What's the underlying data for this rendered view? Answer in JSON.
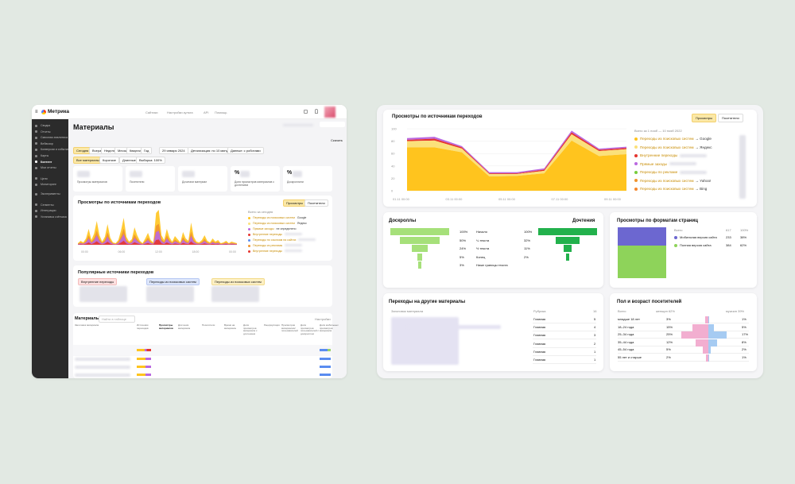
{
  "left_app": {
    "logo": "Метрика",
    "topnav": [
      "Сайтики",
      "Настройки культа",
      "API",
      "Помощь"
    ],
    "sidebar": [
      "Сводка",
      "Отчеты",
      "Сквозная аналитика",
      "Вебвизор",
      "Конверсии и события",
      "Карты",
      "Контент",
      "Мои отчеты",
      "Цели",
      "Мониторинг",
      "Эксперименты",
      "Сегменты",
      "Интеграции",
      "Установка счётчика"
    ],
    "page_title": "Материалы",
    "share": "Скачать",
    "date_tabs": [
      "Сегодня",
      "Вчера",
      "Неделя",
      "Месяц",
      "Квартал",
      "Год"
    ],
    "date_range": "29 января 2024",
    "detail": "Детализация: по 10 минут",
    "data": "Данные: с роботами",
    "filters": [
      "Все материалы",
      "Короткие",
      "Длинные",
      "Выборка: 100%"
    ],
    "metrics": [
      "Просмотры материалов",
      "Посетители",
      "Дочитали материал",
      "Доля просмотров материалов с дочтением",
      "Доскроллили"
    ],
    "metric_values": [
      "",
      "",
      "",
      "%",
      "%"
    ],
    "chart_title": "Просмотры по источникам переходов",
    "chart_toggle": [
      "Просмотры",
      "Посетители"
    ],
    "chart_period": "Всего за сегодня",
    "chart_legend": [
      "Переходы из поисковых систем",
      "Переходы из поисковых систем",
      "Прямые заходы",
      "Внутренние переходы",
      "Переходы по ссылкам на сайтах",
      "Переходы из рекламы",
      "Внутренние переходы"
    ],
    "chart_legend_targets": [
      "Google",
      "Яндекс",
      "не определено",
      "",
      "",
      "",
      ""
    ],
    "chart_xticks": [
      "00:00",
      "06:00",
      "12:00",
      "18:00",
      "00:00"
    ],
    "popular_title": "Популярные источники переходов",
    "popular_tags": [
      "Внутренние переходы",
      "Переходы из поисковых систем",
      "Переходы из поисковых систем"
    ],
    "table_title": "Материалы",
    "table_search": "Найти в таблице",
    "table_settings": "Настройки",
    "table_headers": [
      "Заголовок материала",
      "Источники переходов",
      "Просмотры материалов",
      "Дочтения материала",
      "Посетители",
      "Время на материале",
      "Доля просмотров материала с дочтением",
      "Рециркуляция",
      "Просмотров материалов/ пользователей",
      "Доля просмотров пользователей с доскроллом",
      "Доля мобильных просмотров материала"
    ],
    "table_total": "Итоги и средние"
  },
  "right_app": {
    "sources": {
      "title": "Просмотры по источникам переходов",
      "toggle": [
        "Просмотры",
        "Посетители"
      ],
      "period": "Всего за 1 нояб — 10 нояб 2022",
      "legend": [
        {
          "label": "Переходы из поисковых систем",
          "target": "Google",
          "color": "#ffc41e"
        },
        {
          "label": "Переходы из поисковых систем",
          "target": "Яндекс",
          "color": "#fbe17b"
        },
        {
          "label": "Внутренние переходы",
          "target": "",
          "color": "#e5352f"
        },
        {
          "label": "Прямые заходы",
          "target": "",
          "color": "#ba68e0"
        },
        {
          "label": "Переходы по рекламе",
          "target": "",
          "color": "#77cd3c"
        },
        {
          "label": "Переходы из поисковых систем",
          "target": "Yahoo!",
          "color": "#f0932d"
        },
        {
          "label": "Переходы из поисковых систем",
          "target": "Bing",
          "color": "#f5872e"
        }
      ],
      "arrow": "→"
    },
    "chart_data": {
      "type": "area",
      "x": [
        "02.11 00:00",
        "03.11 00:00",
        "04.11 00:00",
        "05.11 00:00",
        "06.11 00:00",
        "07.11 00:00",
        "08.11 00:00",
        "09.11 00:00",
        "10.11 00:00"
      ],
      "xticks": [
        "01.11 00:00",
        "03.11 00:00",
        "05.11 00:00",
        "07.11 00:00",
        "09.11 00:00"
      ],
      "ylim": [
        0,
        100
      ],
      "yticks": [
        0,
        20,
        40,
        60,
        80,
        100
      ],
      "series": [
        {
          "name": "Переходы из поисковых систем — Google",
          "color": "#ffc41e",
          "values": [
            70,
            70,
            62,
            23,
            24,
            28,
            81,
            56,
            59
          ]
        },
        {
          "name": "Переходы из поисковых систем — Яндекс",
          "color": "#fbe17b",
          "values": [
            10,
            11,
            6,
            4,
            3,
            4,
            10,
            8,
            8
          ]
        },
        {
          "name": "Внутренние переходы",
          "color": "#e5352f",
          "values": [
            2,
            3,
            2,
            1,
            1,
            2,
            3,
            2,
            2
          ]
        },
        {
          "name": "Прямые заходы",
          "color": "#ba68e0",
          "values": [
            3,
            3,
            2,
            2,
            2,
            2,
            3,
            2,
            2
          ]
        }
      ]
    },
    "doscroll": {
      "title": "Доскроллы",
      "title_right": "Дочтения",
      "left_values": [
        "100%",
        "50%",
        "24%",
        "5%",
        "3%"
      ],
      "labels": [
        "Начало",
        "¼ текста",
        "½ текста",
        "Конец",
        "Ниже границы текста"
      ],
      "right_values": [
        "100%",
        "32%",
        "11%",
        "2%",
        ""
      ]
    },
    "formats": {
      "title": "Просмотры по форматам страниц",
      "total": "Всего",
      "total_num": "617",
      "total_pct": "100%",
      "rows": [
        {
          "label": "Мобильная версия сайта",
          "num": "233",
          "pct": "38%",
          "color": "#6c67d0"
        },
        {
          "label": "Полная версия сайта",
          "num": "384",
          "pct": "62%",
          "color": "#8ed35a"
        }
      ]
    },
    "transitions": {
      "title": "Переходы на другие материалы",
      "col1": "Заголовок материала",
      "col2": "Рубрика",
      "col3": "16",
      "rows": [
        {
          "cat": "Главная",
          "n": "5"
        },
        {
          "cat": "Главная",
          "n": "4"
        },
        {
          "cat": "Главная",
          "n": "3"
        },
        {
          "cat": "Главная",
          "n": "2"
        },
        {
          "cat": "Главная",
          "n": "1"
        },
        {
          "cat": "Главная",
          "n": "1"
        }
      ]
    },
    "demographics": {
      "title": "Пол и возраст посетителей",
      "col_total": "Всего",
      "col_female": "женщин 62%",
      "col_male": "мужчин 39%",
      "rows": [
        {
          "age": "младше 18 лет",
          "f": "3%",
          "m": "1%",
          "fv": 3,
          "mv": 1
        },
        {
          "age": "18–24 года",
          "f": "15%",
          "m": "5%",
          "fv": 15,
          "mv": 5
        },
        {
          "age": "25–34 года",
          "f": "25%",
          "m": "17%",
          "fv": 25,
          "mv": 17
        },
        {
          "age": "35–44 года",
          "f": "12%",
          "m": "8%",
          "fv": 12,
          "mv": 8
        },
        {
          "age": "45–54 года",
          "f": "5%",
          "m": "2%",
          "fv": 5,
          "mv": 2
        },
        {
          "age": "55 лет и старше",
          "f": "2%",
          "m": "1%",
          "fv": 2,
          "mv": 1
        }
      ]
    }
  }
}
